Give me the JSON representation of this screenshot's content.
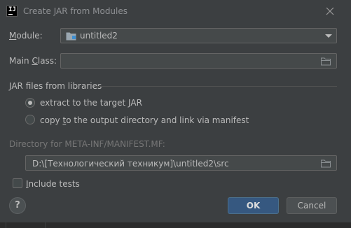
{
  "window": {
    "title": "Create JAR from Modules",
    "app_icon": "intellij-idea-icon",
    "app_icon_text": "IJ"
  },
  "module": {
    "label": "Module:",
    "label_mnemonic": "M",
    "label_rest": "odule:",
    "value": "untitled2",
    "icon": "folder-icon"
  },
  "main_class": {
    "label_prefix": "Main ",
    "label_mnemonic": "C",
    "label_rest": "lass:",
    "value": ""
  },
  "libraries": {
    "section_title": "JAR files from libraries",
    "options": [
      {
        "label": "extract to the target JAR",
        "selected": true
      },
      {
        "label_prefix": "copy ",
        "label_mnemonic": "t",
        "label_rest": "o the output directory and link via manifest",
        "selected": false
      }
    ]
  },
  "manifest": {
    "label": "Directory for META-INF/MANIFEST.MF:",
    "value": "D:\\[Технологический техникум]\\untitled2\\src"
  },
  "include_tests": {
    "label_mnemonic": "I",
    "label_rest": "nclude tests",
    "checked": false
  },
  "buttons": {
    "help": "?",
    "ok": "OK",
    "cancel": "Cancel"
  },
  "colors": {
    "background": "#3c3f41",
    "field_bg": "#45494a",
    "ok_bg": "#365880",
    "text": "#bbbbbb",
    "disabled_text": "#777777"
  }
}
